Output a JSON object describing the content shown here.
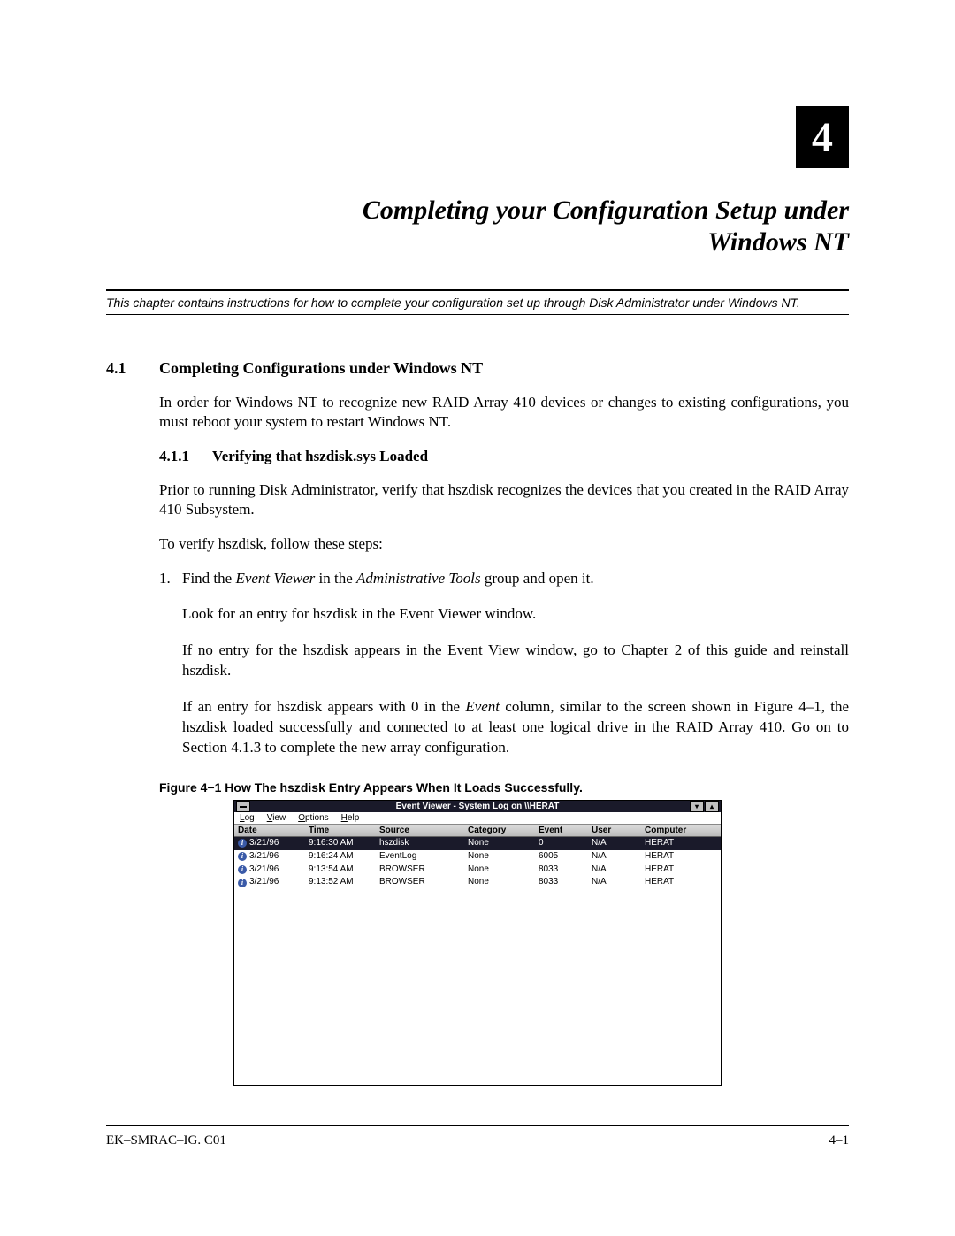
{
  "chapter": {
    "number": "4",
    "title_line1": "Completing your Configuration Setup under",
    "title_line2": "Windows NT",
    "intro": "This chapter contains instructions for how to complete your configuration set up through Disk Administrator under Windows NT."
  },
  "section41": {
    "num": "4.1",
    "title": "Completing Configurations under Windows NT",
    "body": "In order for Windows NT to recognize new RAID Array 410 devices or changes to existing configurations, you must reboot your system to restart Windows NT."
  },
  "section411": {
    "num": "4.1.1",
    "title": "Verifying that hszdisk.sys Loaded",
    "body1": "Prior to running Disk Administrator, verify that hszdisk recognizes the devices that you created in the RAID Array 410 Subsystem.",
    "body2": "To verify hszdisk, follow these steps:",
    "step1_num": "1.",
    "step1_a": "Find the ",
    "step1_b": "Event Viewer",
    "step1_c": " in the ",
    "step1_d": "Administrative Tools",
    "step1_e": " group and open it.",
    "step1_line2": "Look for an entry for hszdisk in the Event Viewer window.",
    "step1_p2": "If no entry for the hszdisk appears in the Event View window, go to Chapter 2 of this guide and reinstall hszdisk.",
    "step1_p3a": "If an entry for hszdisk appears with 0 in the ",
    "step1_p3b": "Event",
    "step1_p3c": " column, similar to the screen shown in Figure 4–1, the hszdisk loaded successfully and connected to at least one logical drive in the RAID Array 410. Go on to Section 4.1.3 to complete the new array configuration."
  },
  "figure": {
    "caption": "Figure 4−1  How The hszdisk Entry Appears When It Loads Successfully."
  },
  "event_viewer": {
    "title": "Event Viewer - System Log on \\\\HERAT",
    "menu": {
      "log": "Log",
      "view": "View",
      "options": "Options",
      "help": "Help"
    },
    "headers": {
      "date": "Date",
      "time": "Time",
      "source": "Source",
      "category": "Category",
      "event": "Event",
      "user": "User",
      "computer": "Computer"
    },
    "rows": [
      {
        "date": "3/21/96",
        "time": "9:16:30 AM",
        "source": "hszdisk",
        "category": "None",
        "event": "0",
        "user": "N/A",
        "computer": "HERAT",
        "selected": true
      },
      {
        "date": "3/21/96",
        "time": "9:16:24 AM",
        "source": "EventLog",
        "category": "None",
        "event": "6005",
        "user": "N/A",
        "computer": "HERAT",
        "selected": false
      },
      {
        "date": "3/21/96",
        "time": "9:13:54 AM",
        "source": "BROWSER",
        "category": "None",
        "event": "8033",
        "user": "N/A",
        "computer": "HERAT",
        "selected": false
      },
      {
        "date": "3/21/96",
        "time": "9:13:52 AM",
        "source": "BROWSER",
        "category": "None",
        "event": "8033",
        "user": "N/A",
        "computer": "HERAT",
        "selected": false
      }
    ]
  },
  "footer": {
    "left": "EK–SMRAC–IG. C01",
    "right": "4–1"
  }
}
